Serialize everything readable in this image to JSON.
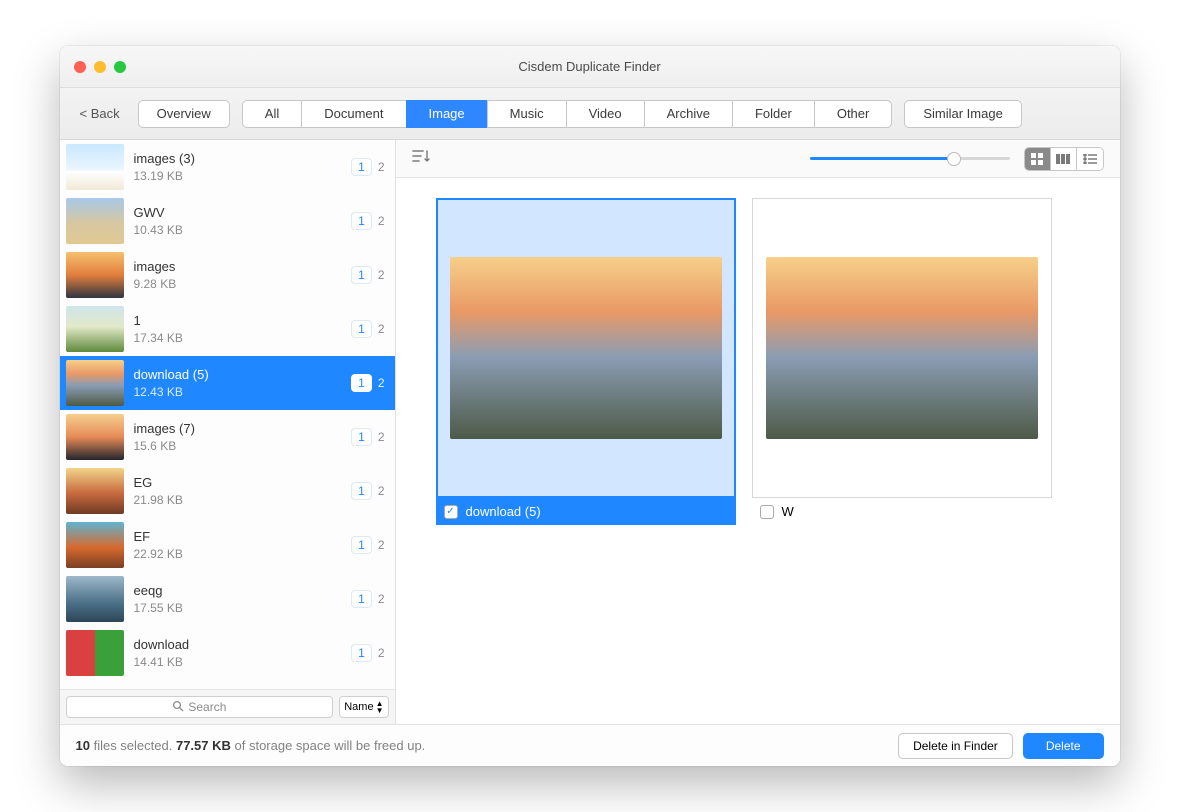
{
  "window": {
    "title": "Cisdem Duplicate Finder"
  },
  "toolbar": {
    "back": "< Back",
    "overview": "Overview",
    "tabs": [
      "All",
      "Document",
      "Image",
      "Music",
      "Video",
      "Archive",
      "Folder",
      "Other"
    ],
    "active_tab_index": 2,
    "similar": "Similar Image"
  },
  "sidebar": {
    "items": [
      {
        "name": "images (3)",
        "size": "13.19 KB",
        "c1": "1",
        "c2": "2",
        "selected": false,
        "thumb": "sky"
      },
      {
        "name": "GWV",
        "size": "10.43 KB",
        "c1": "1",
        "c2": "2",
        "selected": false,
        "thumb": "desert"
      },
      {
        "name": "images",
        "size": "9.28 KB",
        "c1": "1",
        "c2": "2",
        "selected": false,
        "thumb": "sunset1"
      },
      {
        "name": "1",
        "size": "17.34 KB",
        "c1": "1",
        "c2": "2",
        "selected": false,
        "thumb": "field"
      },
      {
        "name": "download (5)",
        "size": "12.43 KB",
        "c1": "1",
        "c2": "2",
        "selected": true,
        "thumb": "dog"
      },
      {
        "name": "images (7)",
        "size": "15.6 KB",
        "c1": "1",
        "c2": "2",
        "selected": false,
        "thumb": "sunset2"
      },
      {
        "name": "EG",
        "size": "21.98 KB",
        "c1": "1",
        "c2": "2",
        "selected": false,
        "thumb": "canyon"
      },
      {
        "name": "EF",
        "size": "22.92 KB",
        "c1": "1",
        "c2": "2",
        "selected": false,
        "thumb": "butterfly"
      },
      {
        "name": "eeqg",
        "size": "17.55 KB",
        "c1": "1",
        "c2": "2",
        "selected": false,
        "thumb": "ocean"
      },
      {
        "name": "download",
        "size": "14.41 KB",
        "c1": "1",
        "c2": "2",
        "selected": false,
        "thumb": "puzzle"
      }
    ],
    "search_placeholder": "Search",
    "sort_label": "Name"
  },
  "preview": {
    "cards": [
      {
        "label": "download (5)",
        "checked": true,
        "selected": true
      },
      {
        "label": "W",
        "checked": false,
        "selected": false
      }
    ]
  },
  "status": {
    "count": "10",
    "mid1": " files selected. ",
    "size": "77.57 KB",
    "mid2": " of storage space will be freed up.",
    "delete_finder": "Delete in Finder",
    "delete": "Delete"
  },
  "thumbs": {
    "sky": "linear-gradient(#c9e8ff 0%,#eaf5ff 55%,#ffffff 60%,#f2e9d7 100%)",
    "desert": "linear-gradient(#a7c9e8 0%,#d7c7a1 55%,#e0c893 100%)",
    "sunset1": "linear-gradient(#f4c06e 0%,#e27e3d 50%,#2e3540 100%)",
    "field": "linear-gradient(#cfe5ec 0%,#e2e9c8 45%,#5f8a3c 100%)",
    "dog": "linear-gradient(#f6d089 0%,#e99966 30%,#8a9db4 55%,#4e5a47 100%)",
    "sunset2": "linear-gradient(#f5cf8f 0%,#e78a57 50%,#23252d 100%)",
    "canyon": "linear-gradient(#f2d48a 0%,#c86a3e 55%,#6f3a24 100%)",
    "butterfly": "linear-gradient(#5fb3d1 0%,#d76a2e 55%,#7a3e23 100%)",
    "ocean": "linear-gradient(#9cb7c9 0%,#4a6f88 60%,#2d4656 100%)",
    "puzzle": "linear-gradient(90deg,#d94141 0%,#d94141 50%,#3aa13a 50%,#3aa13a 100%)"
  }
}
